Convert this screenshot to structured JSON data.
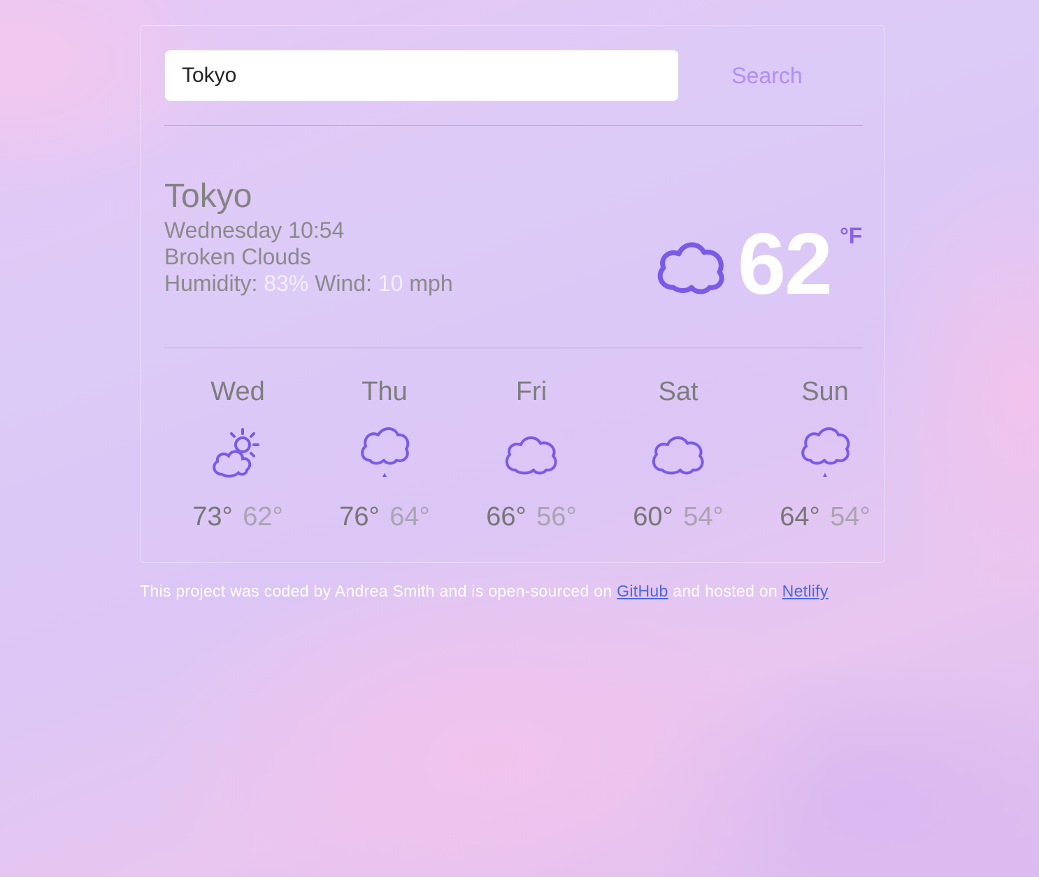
{
  "search": {
    "value": "Tokyo",
    "button_label": "Search"
  },
  "current": {
    "city": "Tokyo",
    "datetime": "Wednesday 10:54",
    "description": "Broken Clouds",
    "humidity_label": "Humidity:",
    "humidity_value": "83%",
    "wind_label": "Wind:",
    "wind_value": "10",
    "wind_unit": "mph",
    "temperature": "62",
    "unit": "°F",
    "icon": "cloud-icon"
  },
  "forecast": [
    {
      "day": "Wed",
      "icon": "partly-sunny-icon",
      "high": "73°",
      "low": "62°"
    },
    {
      "day": "Thu",
      "icon": "rain-cloud-icon",
      "high": "76°",
      "low": "64°"
    },
    {
      "day": "Fri",
      "icon": "cloud-icon",
      "high": "66°",
      "low": "56°"
    },
    {
      "day": "Sat",
      "icon": "cloud-icon",
      "high": "60°",
      "low": "54°"
    },
    {
      "day": "Sun",
      "icon": "rain-cloud-icon",
      "high": "64°",
      "low": "54°"
    }
  ],
  "footer": {
    "text1": "This project was coded by Andrea Smith and is open-sourced on",
    "github": "GitHub",
    "text2": "and hosted on",
    "netlify": "Netlify"
  },
  "colors": {
    "accent": "#8a62e6",
    "icon": "#7a5ae8",
    "search": "#b18ff0",
    "link": "#4c68d8"
  }
}
